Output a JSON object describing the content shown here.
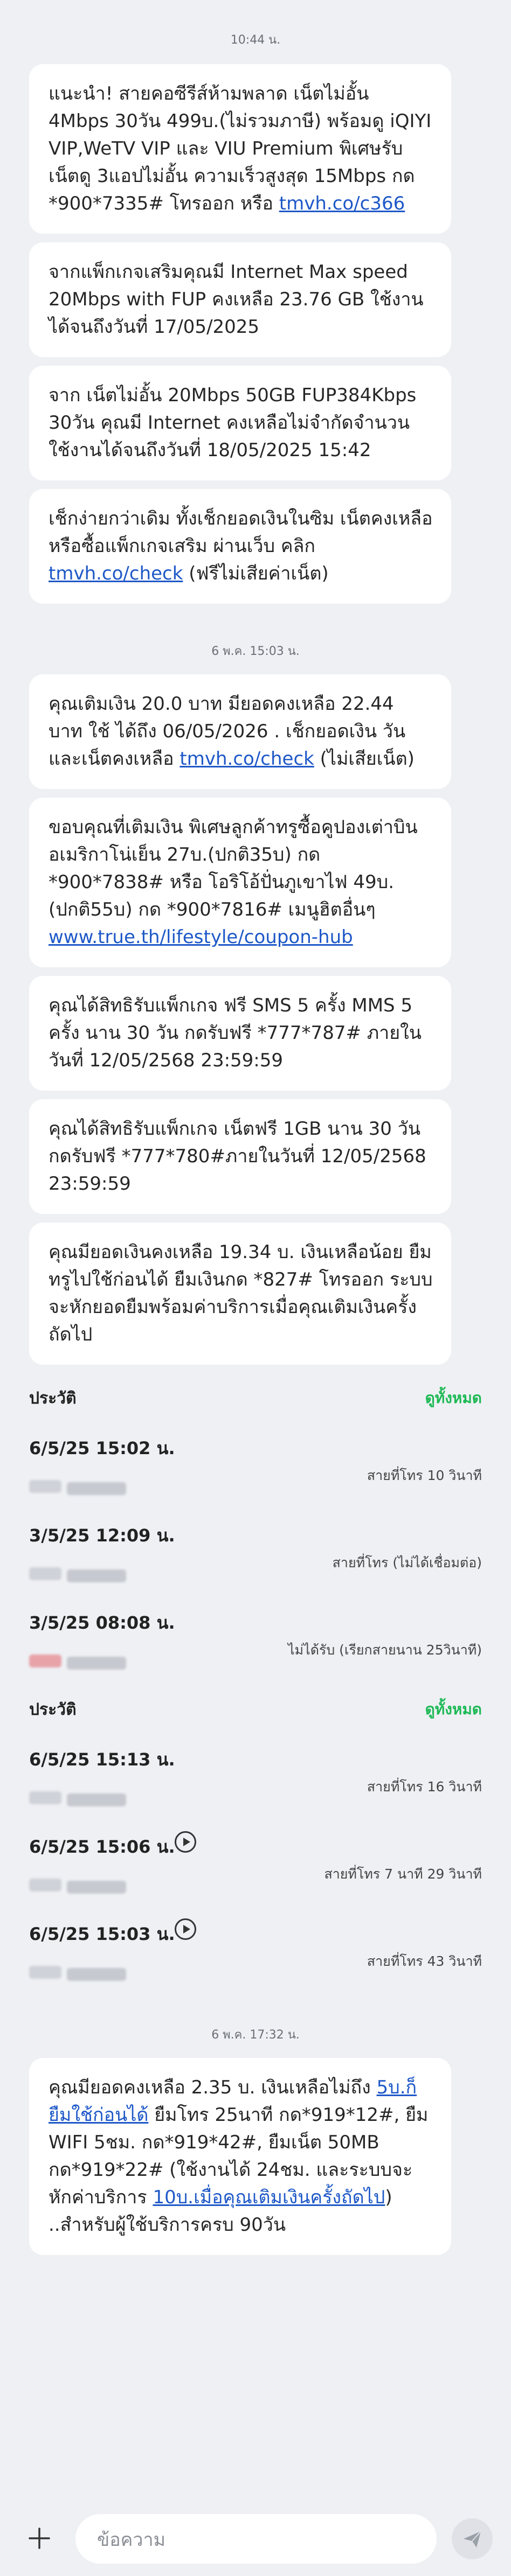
{
  "timestamps": {
    "t1": "10:44 น.",
    "t2": "6 พ.ค. 15:03 น.",
    "t3": "6 พ.ค. 17:32 น."
  },
  "messages_group1": [
    {
      "pre": "แนะนำ! สายคอซีรีส์ห้ามพลาด เน็ตไม่อั้น 4Mbps 30วัน 499บ.(ไม่รวมภาษี) พร้อมดู iQIYI VIP,WeTV VIP และ VIU Premium พิเศษรับเน็ตดู 3แอปไม่อั้น ความเร็วสูงสุด 15Mbps กด *900*7335# โทรออก หรือ ",
      "link": "tmvh.co/c366",
      "post": ""
    },
    {
      "pre": "จากแพ็กเกจเสริมคุณมี Internet Max speed 20Mbps with FUP คงเหลือ 23.76 GB ใช้งานได้จนถึงวันที่ 17/05/2025",
      "link": "",
      "post": ""
    },
    {
      "pre": "จาก เน็ตไม่อั้น 20Mbps 50GB FUP384Kbps 30วัน คุณมี Internet คงเหลือไม่จำกัดจำนวน ใช้งานได้จนถึงวันที่ 18/05/2025 15:42",
      "link": "",
      "post": ""
    },
    {
      "pre": "เช็กง่ายกว่าเดิม ทั้งเช็กยอดเงินในซิม เน็ตคงเหลือ หรือซื้อแพ็กเกจเสริม ผ่านเว็บ คลิก ",
      "link": "tmvh.co/check",
      "post": " (ฟรีไม่เสียค่าเน็ต)"
    }
  ],
  "messages_group2": [
    {
      "pre": "คุณเติมเงิน 20.0 บาท มียอดคงเหลือ 22.44 บาท ใช้ ได้ถึง 06/05/2026 . เช็กยอดเงิน วันและเน็ตคงเหลือ ",
      "link": "tmvh.co/check",
      "post": " (ไม่เสียเน็ต)"
    },
    {
      "pre": "ขอบคุณที่เติมเงิน พิเศษลูกค้าทรูซื้อคูปองเต่าบินอเมริกาโน่เย็น 27บ.(ปกติ35บ) กด *900*7838# หรือ โอริโอ้ปั่นภูเขาไฟ 49บ.(ปกติ55บ) กด *900*7816# เมนูฮิตอื่นๆ ",
      "link": "www.true.th/lifestyle/coupon-hub",
      "post": ""
    },
    {
      "pre": "คุณได้สิทธิรับแพ็กเกจ ฟรี SMS 5 ครั้ง MMS 5 ครั้ง นาน 30 วัน กดรับฟรี *777*787# ภายในวันที่ 12/05/2568 23:59:59",
      "link": "",
      "post": ""
    },
    {
      "pre": "คุณได้สิทธิรับแพ็กเกจ เน็ตฟรี 1GB นาน 30 วัน กดรับฟรี *777*780#ภายในวันที่ 12/05/2568 23:59:59",
      "link": "",
      "post": ""
    },
    {
      "pre": "คุณมียอดเงินคงเหลือ 19.34 บ. เงินเหลือน้อย ยืมทรูไปใช้ก่อนได้ ยืมเงินกด *827# โทรออก ระบบจะหักยอดยืมพร้อมค่าบริการเมื่อคุณเติมเงินครั้งถัดไป",
      "link": "",
      "post": ""
    }
  ],
  "history1": {
    "title": "ประวัติ",
    "see_all": "ดูทั้งหมด",
    "rows": [
      {
        "time": "6/5/25 15:02 น.",
        "status": "สายที่โทร 10 วินาที",
        "has_play": false,
        "missed": false
      },
      {
        "time": "3/5/25 12:09 น.",
        "status": "สายที่โทร (ไม่ได้เชื่อมต่อ)",
        "has_play": false,
        "missed": false
      },
      {
        "time": "3/5/25 08:08 น.",
        "status": "ไม่ได้รับ (เรียกสายนาน 25วินาที)",
        "has_play": false,
        "missed": true
      }
    ]
  },
  "history2": {
    "title": "ประวัติ",
    "see_all": "ดูทั้งหมด",
    "rows": [
      {
        "time": "6/5/25 15:13 น.",
        "status": "สายที่โทร 16 วินาที",
        "has_play": false,
        "missed": false
      },
      {
        "time": "6/5/25 15:06 น.",
        "status": "สายที่โทร 7 นาที 29 วินาที",
        "has_play": true,
        "missed": false
      },
      {
        "time": "6/5/25 15:03 น.",
        "status": "สายที่โทร 43 วินาที",
        "has_play": true,
        "missed": false
      }
    ]
  },
  "messages_group3": [
    {
      "segments": [
        {
          "t": "คุณมียอดคงเหลือ 2.35 บ. เงินเหลือไม่ถึง ",
          "link": false
        },
        {
          "t": "5บ.ก็ยืมใช้ก่อนได้",
          "link": true
        },
        {
          "t": " ยืมโทร 25นาที กด*919*12#, ยืม WIFI 5ชม. กด*919*42#, ยืมเน็ต 50MB กด*919*22# (ใช้งานได้ 24ชม. และระบบจะหักค่าบริการ ",
          "link": false
        },
        {
          "t": "10บ.เมื่อคุณเติมเงินครั้งถัดไป",
          "link": true
        },
        {
          "t": ") ..สำหรับผู้ใช้บริการครบ 90วัน",
          "link": false
        }
      ]
    }
  ],
  "composer": {
    "placeholder": "ข้อความ"
  },
  "colors": {
    "background": "#eef0f4",
    "bubble": "#ffffff",
    "link": "#1e58c8",
    "accent_green": "#1db954"
  },
  "icons": [
    "plus-icon",
    "send-icon",
    "play-icon"
  ]
}
